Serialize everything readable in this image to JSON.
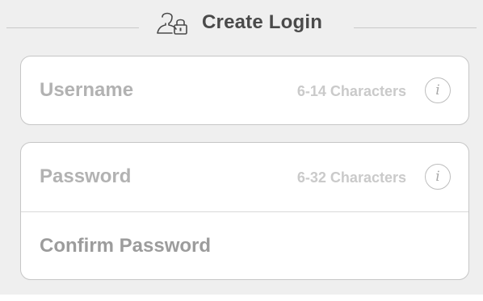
{
  "header": {
    "title": "Create Login",
    "icon": "user-lock-icon"
  },
  "username_field": {
    "label": "Username",
    "hint": "6-14 Characters",
    "info_icon_glyph": "i"
  },
  "password_field": {
    "label": "Password",
    "hint": "6-32 Characters",
    "info_icon_glyph": "i"
  },
  "confirm_password_field": {
    "label": "Confirm Password"
  },
  "colors": {
    "background": "#efefef",
    "card": "#ffffff",
    "border": "#c6c6c6",
    "title_text": "#4a4a4a",
    "label_text": "#b2b2b2",
    "hint_text": "#cacaca"
  }
}
